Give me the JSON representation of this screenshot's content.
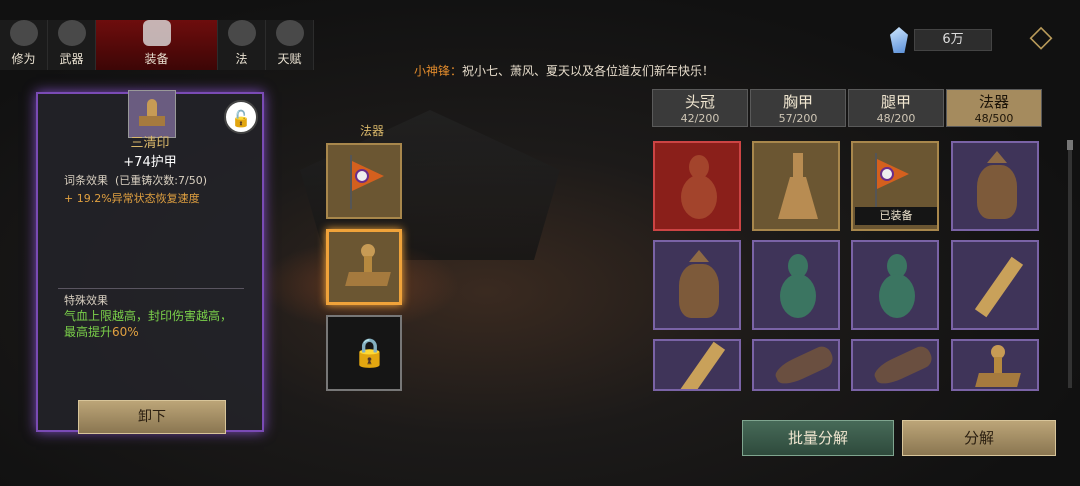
{
  "nav": {
    "tabs": [
      {
        "label": "修为",
        "icon": "cultivation-figure-icon"
      },
      {
        "label": "武器",
        "icon": "sword-icon"
      },
      {
        "label": "装备",
        "icon": "robe-icon",
        "active": true
      },
      {
        "label": "法",
        "icon": "artifact-icon"
      },
      {
        "label": "天赋",
        "icon": "taiji-icon"
      }
    ]
  },
  "currency": {
    "amount": "6万",
    "icon": "crystal-icon"
  },
  "marquee": {
    "speaker": "小神锋：",
    "message": "祝小七、萧风、夏天以及各位道友们新年快乐！"
  },
  "detail": {
    "name": "三清印",
    "stat": "+74护甲",
    "attr_title": "词条效果",
    "reforge": "(已重铸次数:7/50)",
    "attr_line": "+ 19.2%异常状态恢复速度",
    "special_title": "特殊效果",
    "special_text_a": "气血上限越高，封印伤害越高，最高提升",
    "special_pct": "60%",
    "unequip": "卸下",
    "lock_icon": "unlock-icon"
  },
  "slots": {
    "label": "法器"
  },
  "categories": [
    {
      "name": "头冠",
      "count": "42/200"
    },
    {
      "name": "胸甲",
      "count": "57/200"
    },
    {
      "name": "腿甲",
      "count": "48/200"
    },
    {
      "name": "法器",
      "count": "48/500",
      "active": true
    }
  ],
  "inventory": {
    "equipped_tag": "已装备"
  },
  "actions": {
    "batch": "批量分解",
    "decompose": "分解"
  }
}
